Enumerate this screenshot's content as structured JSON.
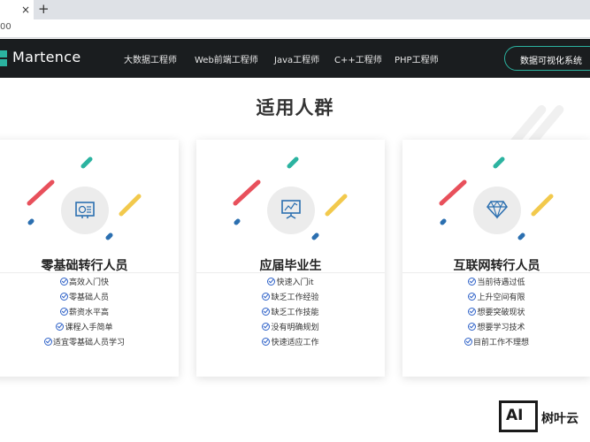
{
  "browser": {
    "tab_close": "×",
    "new_tab": "+",
    "address": "00"
  },
  "navbar": {
    "logo": "Martence",
    "items": [
      "大数据工程师",
      "Web前端工程师",
      "Java工程师",
      "C++工程师",
      "PHP工程师"
    ],
    "cta": "数据可视化系统"
  },
  "section": {
    "title": "适用人群"
  },
  "cards": [
    {
      "title": "零基础转行人员",
      "icon": "monitor-chart-icon",
      "items": [
        "高效入门快",
        "零基础人员",
        "薪资水平高",
        "课程入手简单",
        "适宜零基础人员学习"
      ]
    },
    {
      "title": "应届毕业生",
      "icon": "presentation-board-icon",
      "items": [
        "快速入门it",
        "缺乏工作经验",
        "缺乏工作技能",
        "没有明确规划",
        "快速适应工作"
      ]
    },
    {
      "title": "互联网转行人员",
      "icon": "diamond-icon",
      "items": [
        "当前待遇过低",
        "上升空间有限",
        "想要突破现状",
        "想要学习技术",
        "目前工作不理想"
      ]
    }
  ],
  "watermark": {
    "logo": "AI",
    "text": "树叶云"
  },
  "colors": {
    "nav_bg": "#1a1d1f",
    "accent_teal": "#2bb3a0",
    "red": "#e8505b",
    "yellow": "#f2c94c",
    "check_blue": "#2f62c8"
  }
}
